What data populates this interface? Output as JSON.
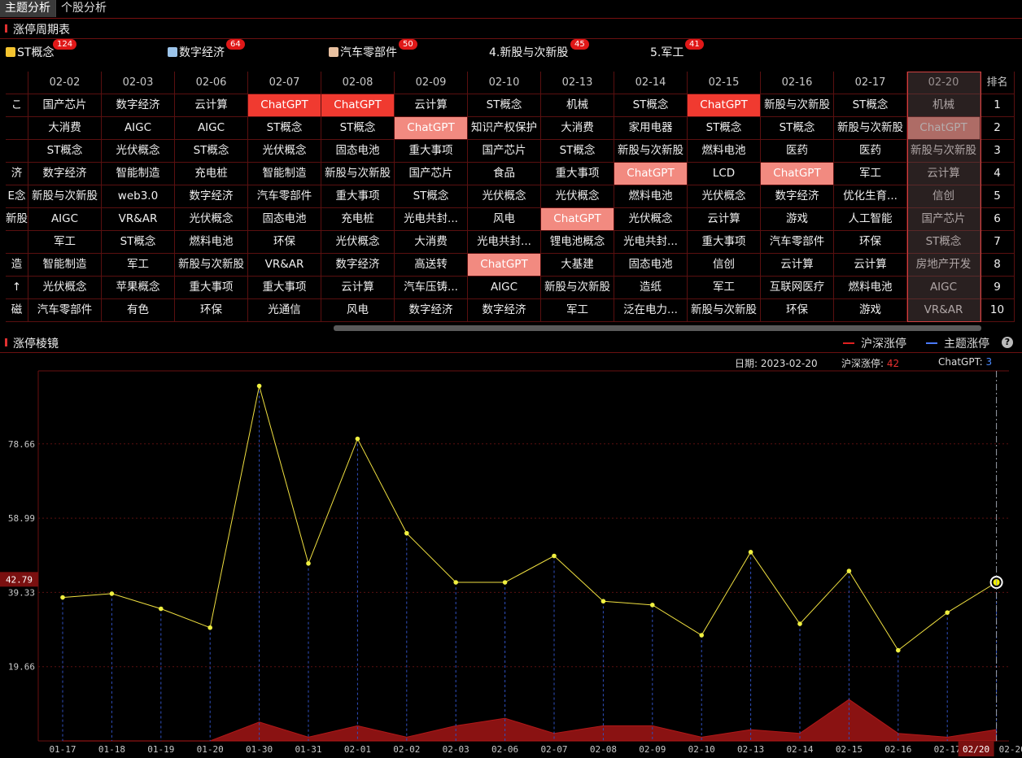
{
  "tabs": [
    "主题分析",
    "个股分析"
  ],
  "section1_title": "涨停周期表",
  "themes": [
    {
      "name": "ST概念",
      "count": "124",
      "cube": "#f4c430"
    },
    {
      "name": "数字经济",
      "count": "64",
      "cube": "#9cc4ea"
    },
    {
      "name": "汽车零部件",
      "count": "50",
      "cube": "#e8c0a0"
    },
    {
      "name": "4.新股与次新股",
      "count": "45",
      "cube": ""
    },
    {
      "name": "5.军工",
      "count": "41",
      "cube": ""
    }
  ],
  "table": {
    "first_col": [
      "こ",
      "",
      "",
      "济",
      "E念",
      "新股",
      "",
      "造",
      "↑",
      "磁"
    ],
    "dates": [
      "02-02",
      "02-03",
      "02-06",
      "02-07",
      "02-08",
      "02-09",
      "02-10",
      "02-13",
      "02-14",
      "02-15",
      "02-16",
      "02-17",
      "02-20"
    ],
    "rank_header": "排名",
    "ranks": [
      "1",
      "2",
      "3",
      "4",
      "5",
      "6",
      "7",
      "8",
      "9",
      "10"
    ],
    "rows": [
      [
        "国产芯片",
        "数字经济",
        "云计算",
        "ChatGPT",
        "ChatGPT",
        "云计算",
        "ST概念",
        "机械",
        "ST概念",
        "ChatGPT",
        "新股与次新股",
        "ST概念",
        "机械"
      ],
      [
        "大消费",
        "AIGC",
        "AIGC",
        "ST概念",
        "ST概念",
        "ChatGPT",
        "知识产权保护",
        "大消费",
        "家用电器",
        "ST概念",
        "ST概念",
        "新股与次新股",
        "ChatGPT"
      ],
      [
        "ST概念",
        "光伏概念",
        "ST概念",
        "光伏概念",
        "固态电池",
        "重大事项",
        "国产芯片",
        "ST概念",
        "新股与次新股",
        "燃料电池",
        "医药",
        "医药",
        "新股与次新股"
      ],
      [
        "数字经济",
        "智能制造",
        "充电桩",
        "智能制造",
        "新股与次新股",
        "国产芯片",
        "食品",
        "重大事项",
        "ChatGPT",
        "LCD",
        "ChatGPT",
        "军工",
        "云计算"
      ],
      [
        "新股与次新股",
        "web3.0",
        "数字经济",
        "汽车零部件",
        "重大事项",
        "ST概念",
        "光伏概念",
        "光伏概念",
        "燃料电池",
        "光伏概念",
        "数字经济",
        "优化生育...",
        "信创"
      ],
      [
        "AIGC",
        "VR&AR",
        "光伏概念",
        "固态电池",
        "充电桩",
        "光电共封...",
        "风电",
        "ChatGPT",
        "光伏概念",
        "云计算",
        "游戏",
        "人工智能",
        "国产芯片"
      ],
      [
        "军工",
        "ST概念",
        "燃料电池",
        "环保",
        "光伏概念",
        "大消费",
        "光电共封...",
        "锂电池概念",
        "光电共封...",
        "重大事项",
        "汽车零部件",
        "环保",
        "ST概念"
      ],
      [
        "智能制造",
        "军工",
        "新股与次新股",
        "VR&AR",
        "数字经济",
        "高送转",
        "ChatGPT",
        "大基建",
        "固态电池",
        "信创",
        "云计算",
        "云计算",
        "房地产开发"
      ],
      [
        "光伏概念",
        "苹果概念",
        "重大事项",
        "重大事项",
        "云计算",
        "汽车压铸...",
        "AIGC",
        "新股与次新股",
        "造纸",
        "军工",
        "互联网医疗",
        "燃料电池",
        "AIGC"
      ],
      [
        "汽车零部件",
        "有色",
        "环保",
        "光通信",
        "风电",
        "数字经济",
        "数字经济",
        "军工",
        "泛在电力...",
        "新股与次新股",
        "环保",
        "游戏",
        "VR&AR"
      ]
    ],
    "red_cells": [
      "0-3",
      "0-4",
      "0-9"
    ],
    "pink_cells": [
      "1-5",
      "1-12",
      "3-8",
      "3-10",
      "5-7",
      "7-6"
    ]
  },
  "section2_title": "涨停棱镜",
  "legend": {
    "market": "沪深涨停",
    "theme": "主题涨停",
    "help": "?"
  },
  "info": {
    "date_label": "日期:",
    "date": "2023-02-20",
    "market_label": "沪深涨停:",
    "market_value": "42",
    "theme_label": "ChatGPT:",
    "theme_value": "3"
  },
  "colors": {
    "line": "#f0e040",
    "area": "#8a1212",
    "drop": "#3050c0",
    "accent": "#e01818"
  },
  "chart_data": {
    "type": "line",
    "x": [
      "01-17",
      "01-18",
      "01-19",
      "01-20",
      "01-30",
      "01-31",
      "02-01",
      "02-02",
      "02-03",
      "02-06",
      "02-07",
      "02-08",
      "02-09",
      "02-10",
      "02-13",
      "02-14",
      "02-15",
      "02-16",
      "02-17",
      "02-20"
    ],
    "series": [
      {
        "name": "沪深涨停",
        "values": [
          38,
          39,
          35,
          30,
          94,
          47,
          80,
          55,
          42,
          42,
          49,
          37,
          36,
          28,
          50,
          31,
          45,
          24,
          34,
          42
        ]
      },
      {
        "name": "主题涨停",
        "values": [
          0,
          0,
          0,
          0,
          5,
          1,
          4,
          1,
          4,
          6,
          2,
          4,
          4,
          1,
          3,
          2,
          11,
          2,
          1,
          3
        ]
      }
    ],
    "yticks": [
      "19.66",
      "39.33",
      "58.99",
      "78.66"
    ],
    "ylim": [
      0,
      98
    ],
    "current_value_label": "42.79",
    "current_x_label": "02/20",
    "last_tick": "02-20"
  }
}
